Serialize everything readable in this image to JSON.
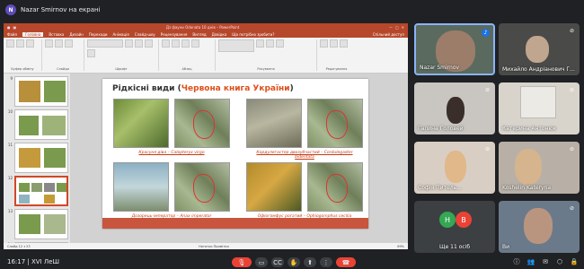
{
  "presenter": {
    "initial": "N",
    "label": "Nazar Smirnov на екрані"
  },
  "ppt": {
    "title": "Дз фауни Odonata 10 днів – PowerPoint",
    "tabs": [
      "Файл",
      "Головна",
      "Вставка",
      "Дизайн",
      "Переходи",
      "Анімація",
      "Слайд-шоу",
      "Рецензування",
      "Вигляд",
      "Довідка",
      "Що потрібно зробити?"
    ],
    "active_tab": "Головна",
    "share_label": "Спільний доступ",
    "ribbon_groups": [
      "Буфер обміну",
      "Слайди",
      "Шрифт",
      "Абзац",
      "Рисування",
      "Редагування"
    ],
    "slide_numbers": [
      "9",
      "10",
      "11",
      "12",
      "13",
      "14"
    ],
    "status_left": "Слайд 12 з 23",
    "status_right": "Нотатки   Примітки",
    "zoom": "69%"
  },
  "slide": {
    "title_black": "Рідкісні види (",
    "title_red": "Червона книга України",
    "title_end": ")",
    "species": [
      {
        "caption": "Красуня діва – Calopteryx virgo"
      },
      {
        "caption": "Кордулегастер двозубчастий – Cordulegaster bidentata"
      },
      {
        "caption": "Дозорець-імператор – Anax imperator"
      },
      {
        "caption": "Офіогомфус рогатий – Ophiogomphus cecilia"
      }
    ]
  },
  "participants": [
    {
      "name": "Nazar Smirnov",
      "mic": "on",
      "active": true
    },
    {
      "name": "Михайло Андріанович Г...",
      "mic": "off",
      "active": false
    },
    {
      "name": "Галина Головей",
      "mic": "off",
      "active": false
    },
    {
      "name": "Катерина Антонюк",
      "mic": "off",
      "active": false
    },
    {
      "name": "Софія Питель...",
      "mic": "off",
      "active": false
    },
    {
      "name": "Koshelin Kateryna",
      "mic": "off",
      "active": false
    },
    {
      "name": "Ще 11 осіб",
      "mic": "none",
      "active": false,
      "avatars": [
        "Н",
        "В"
      ]
    },
    {
      "name": "Ви",
      "mic": "off",
      "active": false
    }
  ],
  "bottom": {
    "time": "16:17",
    "meeting": "XVI ЛеШ"
  }
}
